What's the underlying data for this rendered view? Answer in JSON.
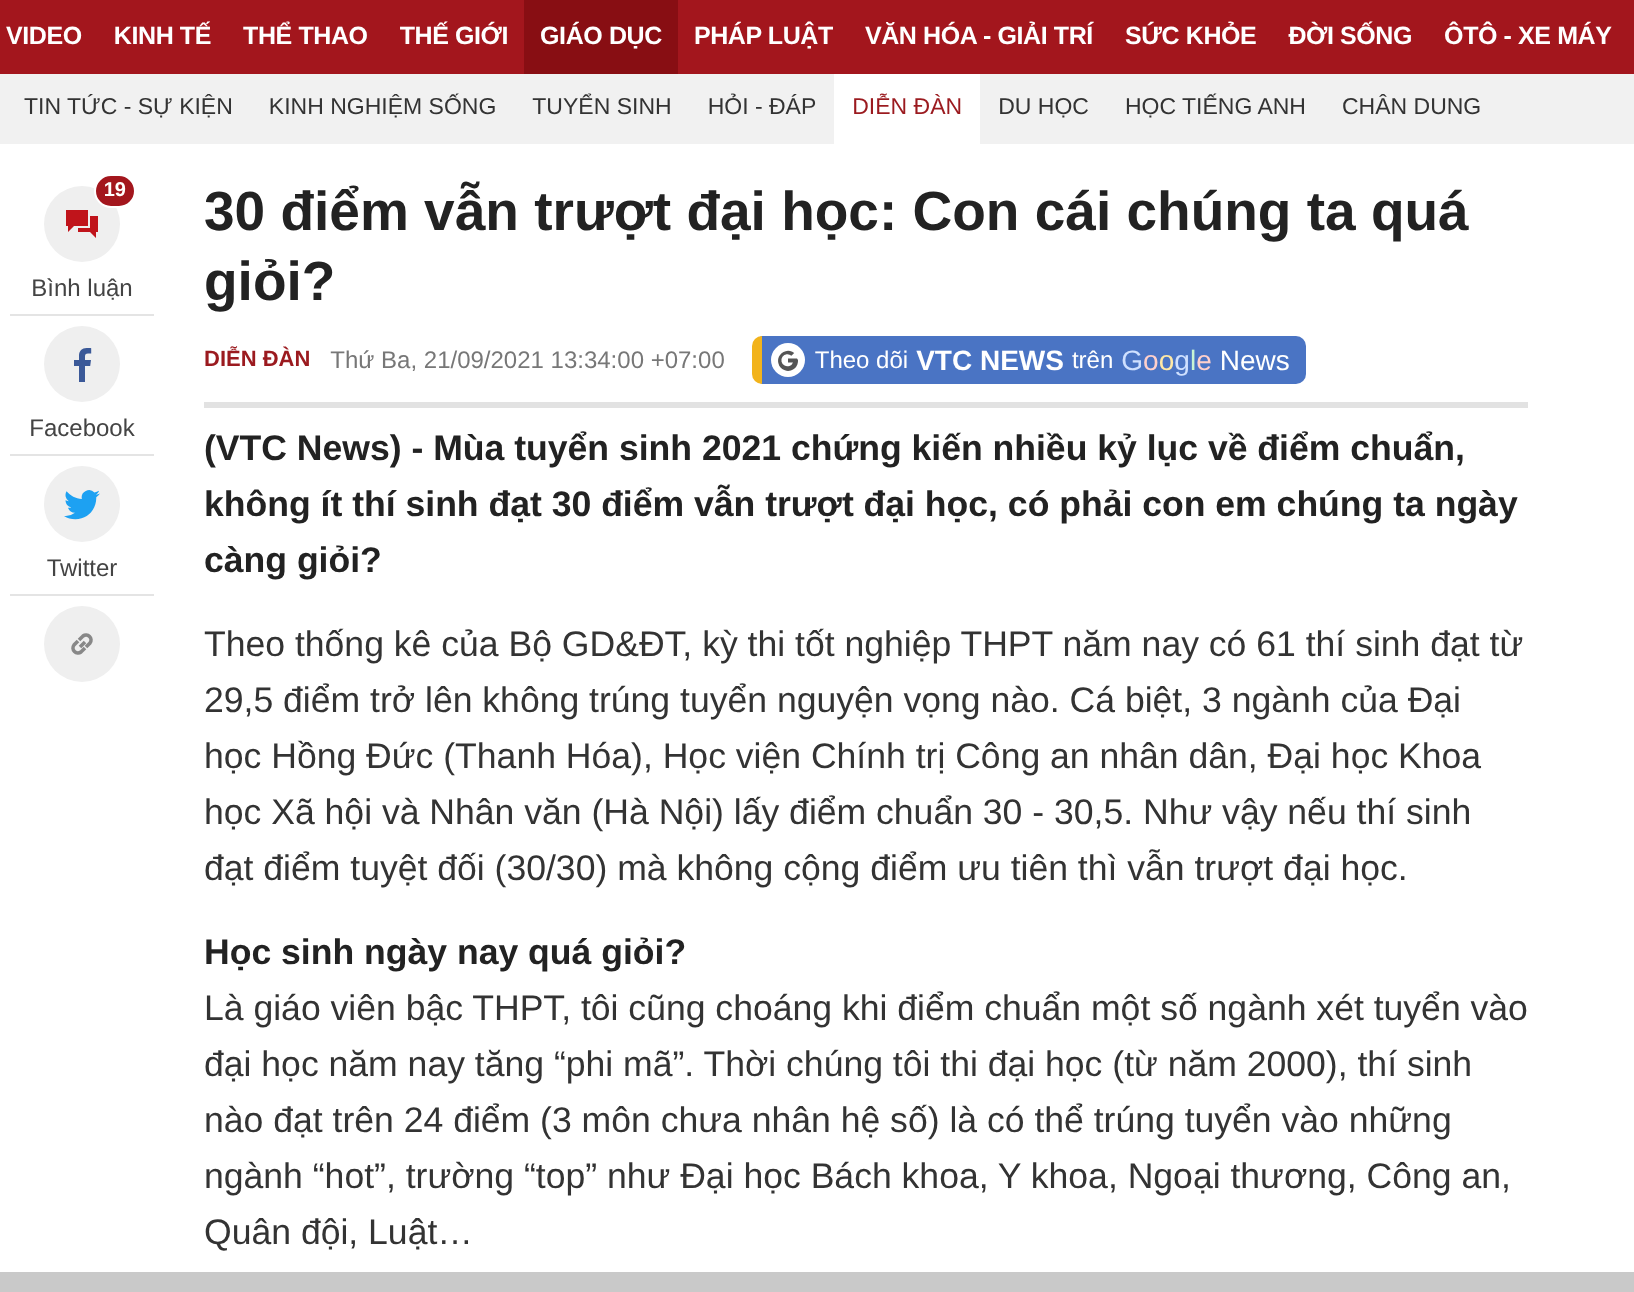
{
  "top_nav": [
    {
      "label": "VIDEO",
      "selected": false
    },
    {
      "label": "KINH TẾ",
      "selected": false
    },
    {
      "label": "THỂ THAO",
      "selected": false
    },
    {
      "label": "THẾ GIỚI",
      "selected": false
    },
    {
      "label": "GIÁO DỤC",
      "selected": true
    },
    {
      "label": "PHÁP LUẬT",
      "selected": false
    },
    {
      "label": "VĂN HÓA - GIẢI TRÍ",
      "selected": false
    },
    {
      "label": "SỨC KHỎE",
      "selected": false
    },
    {
      "label": "ĐỜI SỐNG",
      "selected": false
    },
    {
      "label": "ÔTÔ - XE MÁY",
      "selected": false
    }
  ],
  "sub_nav": [
    {
      "label": "TIN TỨC - SỰ KIỆN",
      "selected": false
    },
    {
      "label": "KINH NGHIỆM SỐNG",
      "selected": false
    },
    {
      "label": "TUYỂN SINH",
      "selected": false
    },
    {
      "label": "HỎI - ĐÁP",
      "selected": false
    },
    {
      "label": "DIỄN ĐÀN",
      "selected": true
    },
    {
      "label": "DU HỌC",
      "selected": false
    },
    {
      "label": "HỌC TIẾNG ANH",
      "selected": false
    },
    {
      "label": "CHÂN DUNG",
      "selected": false
    }
  ],
  "share": [
    {
      "kind": "comment",
      "label": "Bình luận",
      "badge": "19"
    },
    {
      "kind": "facebook",
      "label": "Facebook"
    },
    {
      "kind": "twitter",
      "label": "Twitter"
    },
    {
      "kind": "link"
    }
  ],
  "article": {
    "title": "30 điểm vẫn trượt đại học: Con cái chúng ta quá giỏi?",
    "category": "DIỄN ĐÀN",
    "date": "Thứ Ba, 21/09/2021 13:34:00 +07:00",
    "follow_button": {
      "before": "Theo dõi",
      "brand": "VTC NEWS",
      "middle": "trên",
      "google": "Google",
      "news": "News"
    },
    "lead": "(VTC News) - Mùa tuyển sinh 2021 chứng kiến nhiều kỷ lục về điểm chuẩn, không ít thí sinh đạt 30 điểm vẫn trượt đại học, có phải con em chúng ta ngày càng giỏi?",
    "blocks": [
      {
        "kind": "paragraph",
        "text": "Theo thống kê của Bộ GD&ĐT, kỳ thi tốt nghiệp THPT năm nay có 61 thí sinh đạt từ 29,5 điểm trở lên không trúng tuyển nguyện vọng nào. Cá biệt, 3 ngành của Đại học Hồng Đức (Thanh Hóa), Học viện Chính trị Công an nhân dân, Đại học Khoa học Xã hội và Nhân văn (Hà Nội) lấy điểm chuẩn 30 - 30,5. Như vậy nếu thí sinh đạt điểm tuyệt đối (30/30) mà không cộng điểm ưu tiên thì vẫn trượt đại học."
      },
      {
        "kind": "heading",
        "text": "Học sinh ngày nay quá giỏi?"
      },
      {
        "kind": "paragraph",
        "text": "Là giáo viên bậc THPT, tôi cũng choáng khi điểm chuẩn một số ngành xét tuyển vào đại học năm nay tăng “phi mã”. Thời chúng tôi thi đại học (từ năm 2000), thí sinh nào đạt trên 24 điểm (3 môn chưa nhân hệ số) là có thể trúng tuyển vào những ngành “hot”, trường “top” như Đại học Bách khoa, Y khoa, Ngoại thương, Công an, Quân đội, Luật…"
      }
    ]
  }
}
